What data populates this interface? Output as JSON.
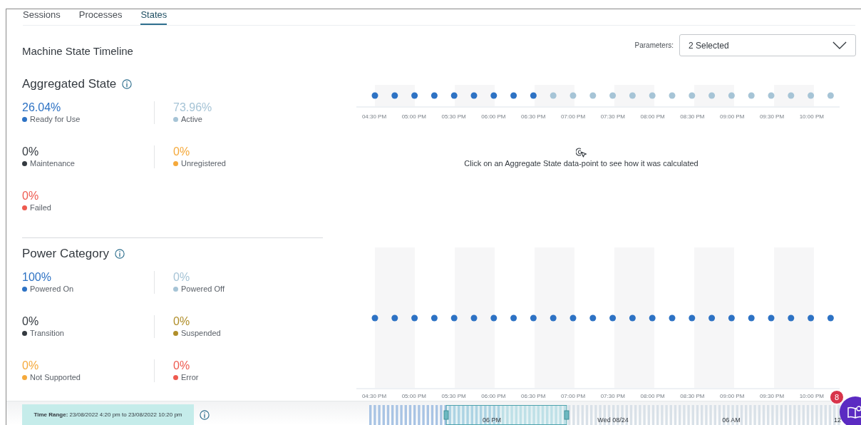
{
  "tabs": [
    {
      "label": "Sessions",
      "selected": false
    },
    {
      "label": "Processes",
      "selected": false
    },
    {
      "label": "States",
      "selected": true
    }
  ],
  "title": "Machine State Timeline",
  "parameters": {
    "label": "Parameters:",
    "value": "2 Selected"
  },
  "sections": [
    {
      "heading": "Aggregated State",
      "stats": [
        {
          "value": "26.04%",
          "label": "Ready for Use",
          "color": "#2d72c4"
        },
        {
          "value": "73.96%",
          "label": "Active",
          "color": "#a6c4d6"
        },
        {
          "value": "0%",
          "label": "Maintenance",
          "color": "#343a40"
        },
        {
          "value": "0%",
          "label": "Unregistered",
          "color": "#f5a93b"
        },
        {
          "value": "0%",
          "label": "Failed",
          "color": "#ee5a4f"
        }
      ]
    },
    {
      "heading": "Power Category",
      "stats": [
        {
          "value": "100%",
          "label": "Powered On",
          "color": "#2d72c4"
        },
        {
          "value": "0%",
          "label": "Powered Off",
          "color": "#a6c4d6"
        },
        {
          "value": "0%",
          "label": "Transition",
          "color": "#343a40"
        },
        {
          "value": "0%",
          "label": "Suspended",
          "color": "#b08e2a"
        },
        {
          "value": "0%",
          "label": "Not Supported",
          "color": "#f5a93b"
        },
        {
          "value": "0%",
          "label": "Error",
          "color": "#ee5a4f"
        }
      ]
    }
  ],
  "timelines": [
    {
      "ticks": [
        "04:30 PM",
        "05:00 PM",
        "05:30 PM",
        "06:00 PM",
        "06:30 PM",
        "07:00 PM",
        "07:30 PM",
        "08:00 PM",
        "08:30 PM",
        "09:00 PM",
        "09:30 PM",
        "10:00 PM"
      ],
      "points": [
        {
          "color": "#2d72c4"
        },
        {
          "color": "#2d72c4"
        },
        {
          "color": "#2d72c4"
        },
        {
          "color": "#2d72c4"
        },
        {
          "color": "#2d72c4"
        },
        {
          "color": "#2d72c4"
        },
        {
          "color": "#2d72c4"
        },
        {
          "color": "#2d72c4"
        },
        {
          "color": "#2d72c4"
        },
        {
          "color": "#a6c4d6"
        },
        {
          "color": "#a6c4d6"
        },
        {
          "color": "#a6c4d6"
        },
        {
          "color": "#a6c4d6"
        },
        {
          "color": "#a6c4d6"
        },
        {
          "color": "#a6c4d6"
        },
        {
          "color": "#a6c4d6"
        },
        {
          "color": "#a6c4d6"
        },
        {
          "color": "#a6c4d6"
        },
        {
          "color": "#a6c4d6"
        },
        {
          "color": "#a6c4d6"
        },
        {
          "color": "#a6c4d6"
        },
        {
          "color": "#a6c4d6"
        },
        {
          "color": "#a6c4d6"
        },
        {
          "color": "#a6c4d6"
        }
      ]
    },
    {
      "ticks": [
        "04:30 PM",
        "05:00 PM",
        "05:30 PM",
        "06:00 PM",
        "06:30 PM",
        "07:00 PM",
        "07:30 PM",
        "08:00 PM",
        "08:30 PM",
        "09:00 PM",
        "09:30 PM",
        "10:00 PM"
      ],
      "points": [
        {
          "color": "#2d72c4"
        },
        {
          "color": "#2d72c4"
        },
        {
          "color": "#2d72c4"
        },
        {
          "color": "#2d72c4"
        },
        {
          "color": "#2d72c4"
        },
        {
          "color": "#2d72c4"
        },
        {
          "color": "#2d72c4"
        },
        {
          "color": "#2d72c4"
        },
        {
          "color": "#2d72c4"
        },
        {
          "color": "#2d72c4"
        },
        {
          "color": "#2d72c4"
        },
        {
          "color": "#2d72c4"
        },
        {
          "color": "#2d72c4"
        },
        {
          "color": "#2d72c4"
        },
        {
          "color": "#2d72c4"
        },
        {
          "color": "#2d72c4"
        },
        {
          "color": "#2d72c4"
        },
        {
          "color": "#2d72c4"
        },
        {
          "color": "#2d72c4"
        },
        {
          "color": "#2d72c4"
        },
        {
          "color": "#2d72c4"
        },
        {
          "color": "#2d72c4"
        },
        {
          "color": "#2d72c4"
        },
        {
          "color": "#2d72c4"
        }
      ]
    }
  ],
  "hint": "Click on an Aggregate State data-point to see how it was calculated",
  "footer": {
    "time_range": "**Time Range:** 23/08/2022 4:20 pm to 23/08/2022 10:20 pm",
    "navigator_labels": [
      "06 PM",
      "Wed 08/24",
      "06 AM",
      "12"
    ]
  },
  "help": {
    "badge": "8"
  }
}
